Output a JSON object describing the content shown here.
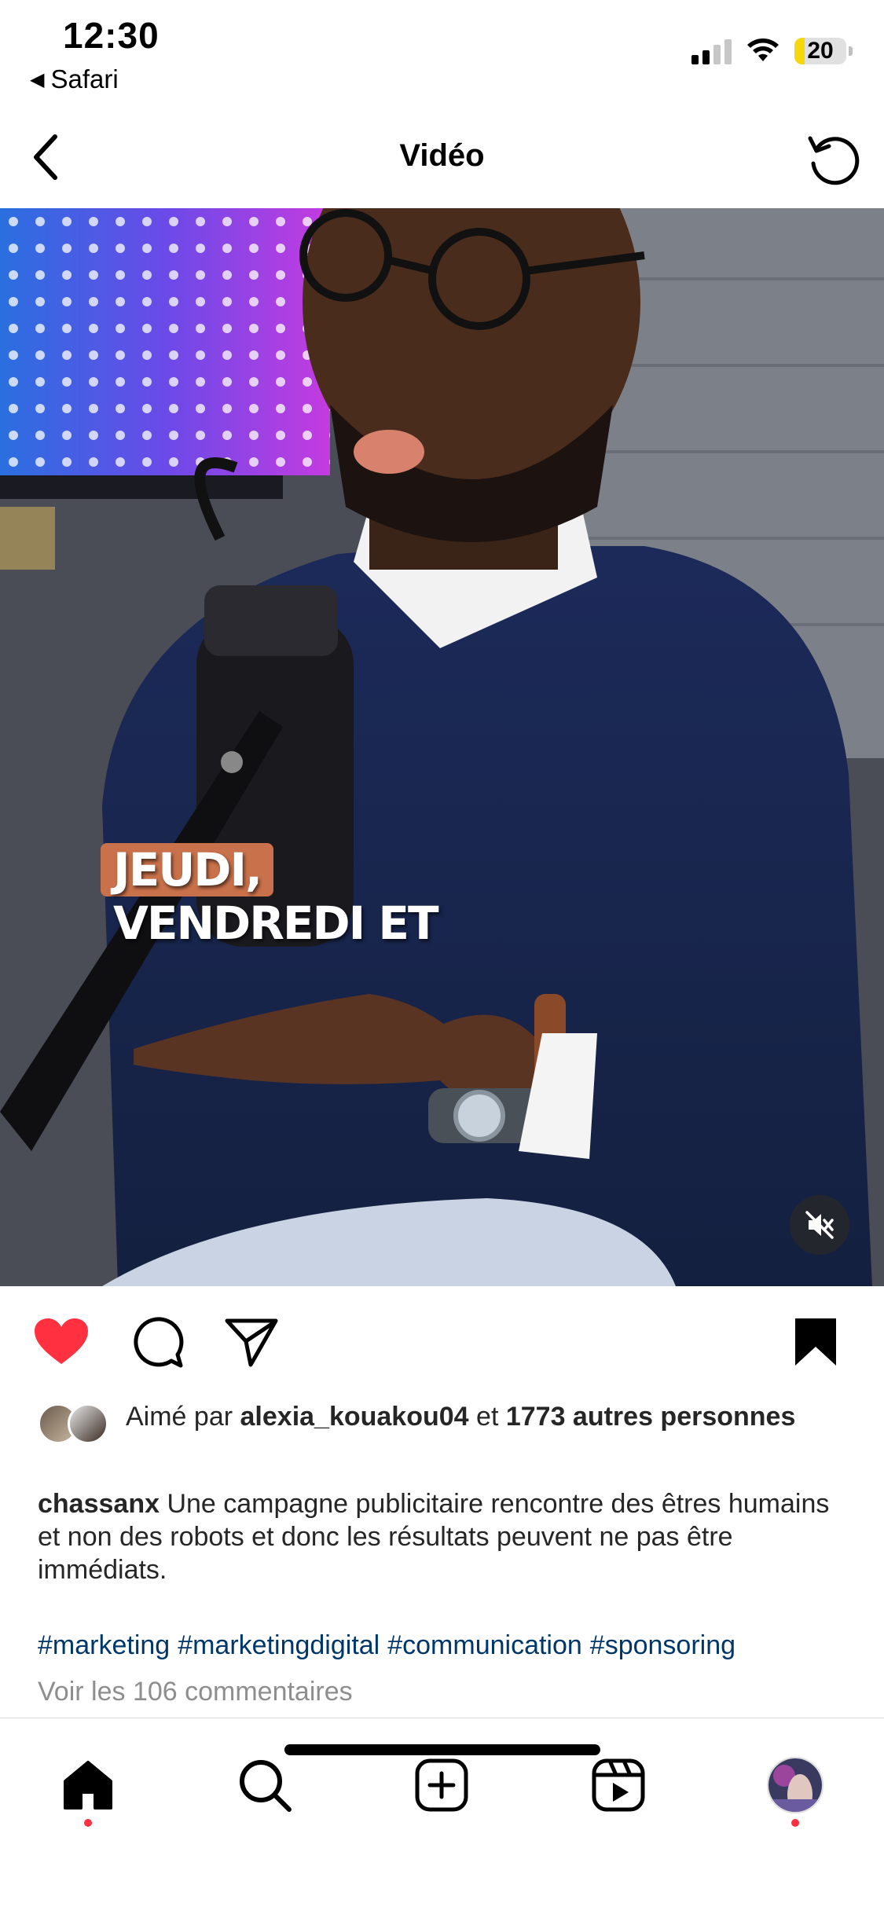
{
  "status_bar": {
    "time": "12:30",
    "back_app": "Safari",
    "battery": "20",
    "battery_level_percent": 20,
    "signal_bars_active": 2,
    "battery_color": "#f5d80b"
  },
  "header": {
    "title": "Vidéo",
    "back_icon": "chevron-left-icon",
    "refresh_icon": "refresh-icon"
  },
  "video": {
    "caption_line1": "JEUDI,",
    "caption_line2": "VENDREDI ET",
    "caption_highlight_color": "#c9714a",
    "mute_icon": "speaker-muted-icon"
  },
  "actions": {
    "like_icon": "heart-filled-icon",
    "like_color": "#ff3040",
    "comment_icon": "comment-icon",
    "share_icon": "paper-plane-icon",
    "save_icon": "bookmark-filled-icon"
  },
  "likes": {
    "prefix": "Aimé par",
    "user": "alexia_kouakou04",
    "connector": "et",
    "others": "1773 autres personnes"
  },
  "post": {
    "username": "chassanx",
    "text": "Une campagne publicitaire rencontre des êtres humains et non des robots et donc les résultats peuvent ne pas être immédiats.",
    "hashtags": [
      "#marketing",
      "#marketingdigital",
      "#communication",
      "#sponsoring"
    ],
    "hashtag_color": "#00376b",
    "comments_link": "Voir les 106 commentaires"
  },
  "bottom_nav": {
    "items": [
      "home-icon",
      "search-icon",
      "create-post-icon",
      "reels-icon",
      "profile-avatar"
    ],
    "notification_color": "#ff3040"
  }
}
